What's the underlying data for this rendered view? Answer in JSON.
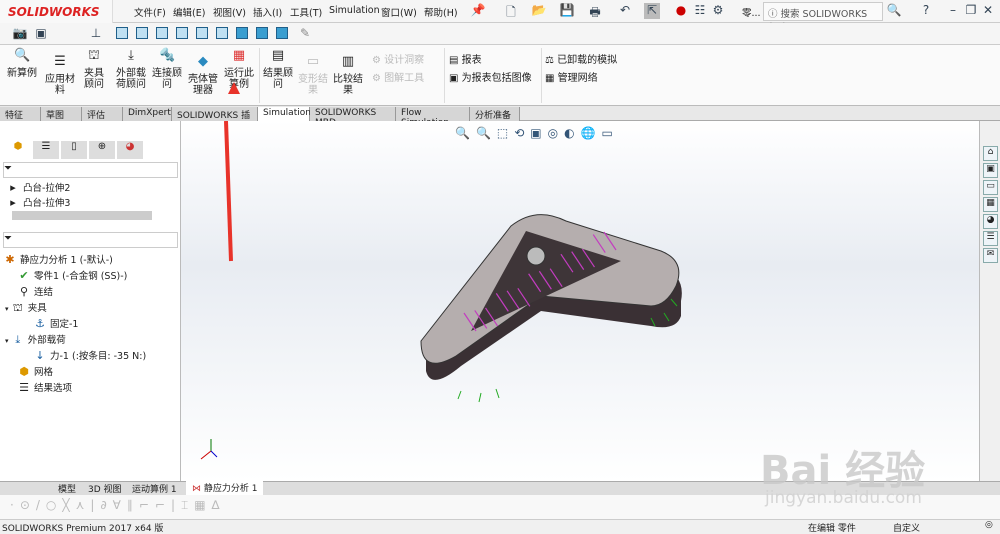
{
  "app": {
    "logo": "SOLIDWORKS"
  },
  "menu": [
    "文件(F)",
    "编辑(E)",
    "视图(V)",
    "插入(I)",
    "工具(T)",
    "Simulation",
    "窗口(W)",
    "帮助(H)"
  ],
  "titlebar": {
    "user_short": "零...",
    "search_placeholder": "搜索 SOLIDWORKS 帮助"
  },
  "ribbon": {
    "buttons": [
      {
        "label": "新算例",
        "enabled": true
      },
      {
        "label": "应用材料",
        "enabled": true
      },
      {
        "label": "夹具顾问",
        "enabled": true
      },
      {
        "label": "外部载荷顾问",
        "enabled": true
      },
      {
        "label": "连接顾问",
        "enabled": true
      },
      {
        "label": "壳体管理器",
        "enabled": true
      },
      {
        "label": "运行此算例",
        "enabled": true
      },
      {
        "label": "结果顾问",
        "enabled": true
      },
      {
        "label": "变形结果",
        "enabled": false
      },
      {
        "label": "比较结果",
        "enabled": true
      }
    ],
    "small": [
      {
        "label": "设计洞察",
        "enabled": false
      },
      {
        "label": "图解工具",
        "enabled": false
      },
      {
        "label": "报表",
        "enabled": true
      },
      {
        "label": "为报表包括图像",
        "enabled": true
      },
      {
        "label": "已卸载的模拟",
        "enabled": true
      },
      {
        "label": "管理网络",
        "enabled": true
      }
    ]
  },
  "tabs": [
    {
      "label": "特征",
      "active": false
    },
    {
      "label": "草图",
      "active": false
    },
    {
      "label": "评估",
      "active": false
    },
    {
      "label": "DimXpert",
      "active": false
    },
    {
      "label": "SOLIDWORKS 插件",
      "active": false
    },
    {
      "label": "Simulation",
      "active": true
    },
    {
      "label": "SOLIDWORKS MBD",
      "active": false
    },
    {
      "label": "Flow Simulation",
      "active": false
    },
    {
      "label": "分析准备",
      "active": false
    }
  ],
  "feature_tree": [
    "凸台-拉伸2",
    "凸台-拉伸3"
  ],
  "sim_tree": [
    {
      "label": "静应力分析 1 (-默认-)",
      "indent": 0
    },
    {
      "label": "零件1 (-合金钢 (SS)-)",
      "indent": 1
    },
    {
      "label": "连结",
      "indent": 1
    },
    {
      "label": "夹具",
      "indent": 1
    },
    {
      "label": "固定-1",
      "indent": 2
    },
    {
      "label": "外部载荷",
      "indent": 1
    },
    {
      "label": "力-1 (:按条目: -35 N:)",
      "indent": 2
    },
    {
      "label": "网格",
      "indent": 1
    },
    {
      "label": "结果选项",
      "indent": 1
    }
  ],
  "bottom_tabs": [
    "模型",
    "3D 视图",
    "运动算例 1",
    "静应力分析 1"
  ],
  "status": {
    "app": "SOLIDWORKS Premium 2017 x64 版",
    "mode": "在编辑 零件",
    "custom": "自定义"
  },
  "watermark": {
    "text": "Bai 经验",
    "url": "jingyan.baidu.com"
  },
  "colors": {
    "accent": "#d22",
    "arrow": "#e8332a"
  }
}
